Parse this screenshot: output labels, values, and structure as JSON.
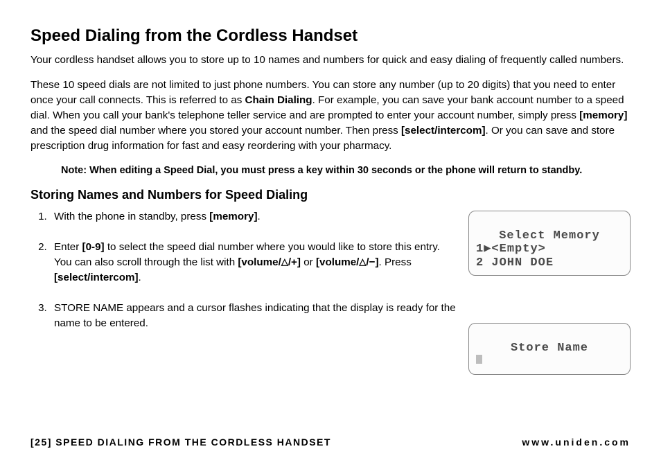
{
  "title": "Speed Dialing from the Cordless Handset",
  "intro_1": "Your cordless handset allows you to store up to 10 names and numbers for quick and easy dialing of frequently called numbers.",
  "intro_2a": "These 10 speed dials are not limited to just phone numbers. You can store any number (up to 20 digits) that you need to enter once your call connects. This is referred to as ",
  "chain_dialing": "Chain Dialing",
  "intro_2b": ". For example, you can save your bank account number to a speed dial. When you call your bank's telephone teller service and are prompted to enter your account number, simply press ",
  "key_memory": "[memory]",
  "intro_2c": " and the speed dial number where you stored your account number. Then press ",
  "key_select": "[select/intercom]",
  "intro_2d": ". Or you can save and store prescription drug information for fast and easy reordering with your pharmacy.",
  "note": "Note: When editing a Speed Dial, you must press a key within 30 seconds or the phone will return to standby.",
  "subtitle": "Storing Names and Numbers for Speed Dialing",
  "steps": {
    "s1a": "With the phone in standby, press ",
    "s1b": ".",
    "s2a": "Enter ",
    "key_09": "[0-9]",
    "s2b": " to select the speed dial number where you would like to store this entry. You can also scroll through the list with ",
    "key_volup_a": "[volume/",
    "key_volup_b": "/+]",
    "s2c": " or ",
    "key_voldn_a": "[volume/",
    "key_voldn_b": "/−]",
    "s2d": ". Press ",
    "s2e": ".",
    "s3": "STORE NAME appears and a cursor flashes indicating that the display is ready for the name to be entered."
  },
  "lcd1": {
    "line1": "Select Memory",
    "line2": "1▶<Empty>",
    "line3": "2 JOHN DOE"
  },
  "lcd2": {
    "line1": "Store Name"
  },
  "footer": {
    "page_num": "[25]",
    "section": "SPEED DIALING FROM THE CORDLESS HANDSET",
    "url": "www.uniden.com"
  }
}
